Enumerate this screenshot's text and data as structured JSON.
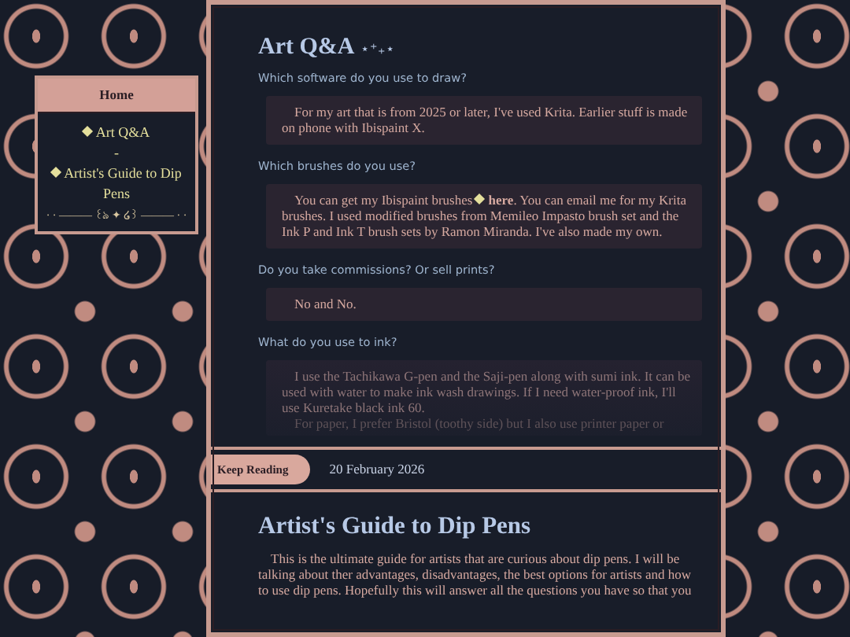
{
  "sidebar": {
    "header": "Home",
    "links": [
      {
        "label": "Art Q&A"
      },
      {
        "label": "Artist's Guide to Dip Pens"
      }
    ],
    "separator": "-",
    "divider": "· · ——— ꒰ঌ ✦ ໒꒱ ——— · ·"
  },
  "posts": [
    {
      "title": "Art Q&A",
      "title_decoration": "⋆⁺₊⋆",
      "qa": [
        {
          "question": "Which software do you use to draw?",
          "answer": [
            {
              "text": "For my art that is from 2025 or later, I've used Krita. Earlier stuff is made on phone with Ibispaint X."
            }
          ]
        },
        {
          "question": "Which brushes do you use?",
          "answer": [
            {
              "text": "You can get my Ibispaint brushes",
              "link": "here",
              "after": ". You can email me for my Krita brushes. I used modified brushes from Memileo Impasto brush set and the Ink P and Ink T brush sets by Ramon Miranda. I've also made my own."
            }
          ]
        },
        {
          "question": "Do you take commissions? Or sell prints?",
          "answer": [
            {
              "text": "No and No."
            }
          ]
        },
        {
          "question": "What do you use to ink?",
          "answer": [
            {
              "text": "I use the Tachikawa G-pen and the Saji-pen along with sumi ink. It can be used with water to make ink wash drawings. If I need water-proof ink, I'll use Kuretake black ink 60."
            },
            {
              "text": "For paper, I prefer Bristol (toothy side) but I also use printer paper or"
            }
          ],
          "faded": true
        }
      ],
      "button": "Keep Reading",
      "date": "20 February 2026"
    },
    {
      "title": "Artist's Guide to Dip Pens",
      "body": "This is the ultimate guide for artists that are curious about dip pens. I will be talking about ther advantages, disadvantages, the best options for artists and how to use dip pens. Hopefully this will answer all the questions you have so that you"
    }
  ]
}
